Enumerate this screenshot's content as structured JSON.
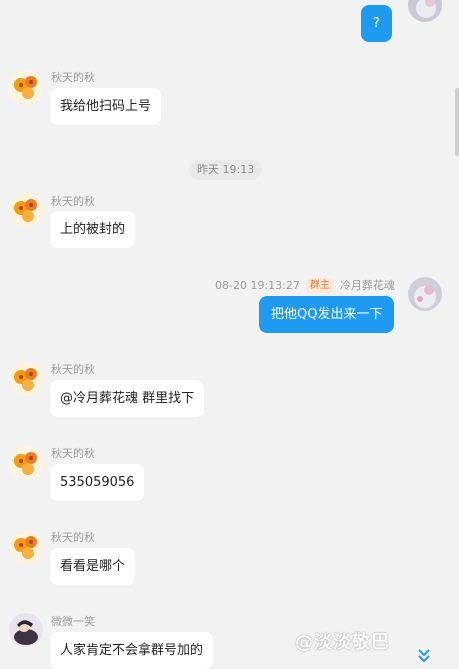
{
  "colors": {
    "accent": "#1e9bf0",
    "background": "#f2f2f2",
    "bubble_in": "#ffffff"
  },
  "messages": [
    {
      "dir": "out",
      "text": "?"
    },
    {
      "dir": "in",
      "sender": "秋天的秋",
      "text": "我给他扫码上号"
    },
    {
      "dir": "time",
      "text": "昨天 19:13"
    },
    {
      "dir": "in",
      "sender": "秋天的秋",
      "text": "上的被封的"
    },
    {
      "dir": "out",
      "timestamp": "08-20 19:13:27",
      "badge": "群主",
      "sender": "冷月葬花魂",
      "text": "把他QQ发出来一下"
    },
    {
      "dir": "in",
      "sender": "秋天的秋",
      "text": "@冷月葬花魂 群里找下"
    },
    {
      "dir": "in",
      "sender": "秋天的秋",
      "text": "535059056"
    },
    {
      "dir": "in",
      "sender": "秋天的秋",
      "text": "看看是哪个"
    },
    {
      "dir": "in",
      "sender": "微微一笑",
      "text": "人家肯定不会拿群号加的"
    }
  ],
  "watermark": {
    "text": "@淡淡敬巴"
  },
  "icons": {
    "scroll_down": "double-chevron-down-icon"
  }
}
